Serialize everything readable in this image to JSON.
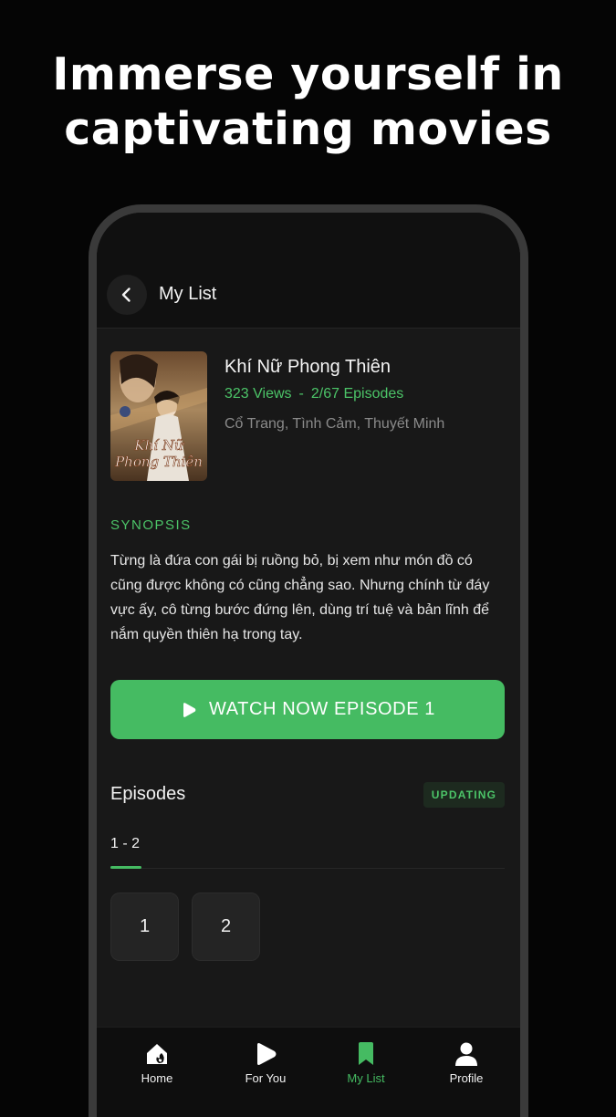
{
  "promo": {
    "line1": "Immerse yourself in",
    "line2": "captivating movies"
  },
  "header": {
    "back_icon": "chevron-left-icon",
    "title": "My List"
  },
  "movie": {
    "title": "Khí Nữ Phong Thiên",
    "views": "323 Views",
    "separator": "-",
    "episodes_progress": "2/67 Episodes",
    "genres": "Cổ Trang, Tình Cảm, Thuyết Minh",
    "poster_text": "Khí Nữ Phong Thiên"
  },
  "synopsis": {
    "label": "SYNOPSIS",
    "text": "Từng là đứa con gái bị ruồng bỏ, bị xem như món đồ có cũng được không có cũng chẳng sao. Nhưng chính từ đáy vực ấy, cô từng bước đứng lên, dùng trí tuệ và bản lĩnh để nắm quyền thiên hạ trong tay."
  },
  "watch_button": {
    "label": "WATCH NOW EPISODE 1",
    "icon": "play-icon"
  },
  "episodes": {
    "title": "Episodes",
    "status_badge": "UPDATING",
    "range_tab": "1 - 2",
    "items": [
      "1",
      "2"
    ]
  },
  "nav": {
    "items": [
      {
        "label": "Home",
        "icon": "home-icon",
        "active": false
      },
      {
        "label": "For You",
        "icon": "play-bubble-icon",
        "active": false
      },
      {
        "label": "My List",
        "icon": "bookmark-icon",
        "active": true
      },
      {
        "label": "Profile",
        "icon": "user-icon",
        "active": false
      }
    ]
  },
  "colors": {
    "accent": "#45bb62",
    "background": "#050505",
    "screen": "#181818"
  }
}
